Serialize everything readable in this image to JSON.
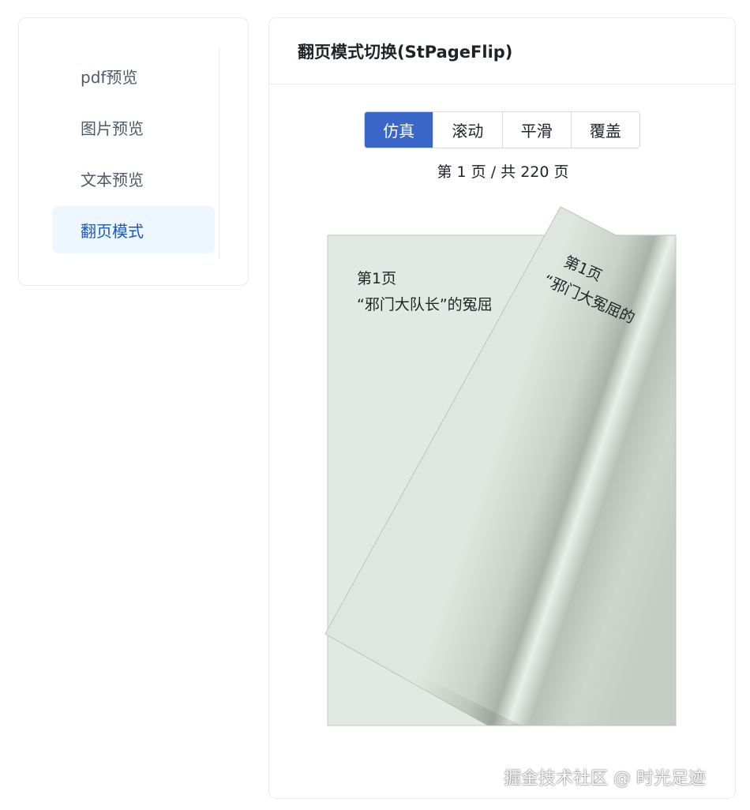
{
  "sidebar": {
    "items": [
      {
        "label": "pdf预览",
        "active": false
      },
      {
        "label": "图片预览",
        "active": false
      },
      {
        "label": "文本预览",
        "active": false
      },
      {
        "label": "翻页模式",
        "active": true
      }
    ]
  },
  "panel": {
    "title": "翻页模式切换(StPageFlip)",
    "modes": [
      {
        "label": "仿真",
        "active": true
      },
      {
        "label": "滚动",
        "active": false
      },
      {
        "label": "平滑",
        "active": false
      },
      {
        "label": "覆盖",
        "active": false
      }
    ],
    "page_indicator": "第 1 页 / 共 220 页"
  },
  "book": {
    "page_heading": "第1页",
    "page_text": "“邪门大队长”的冤屈",
    "flip_heading": "第1页",
    "flip_text": "“邪门大冤屈的",
    "page_color": "#e2e9e2",
    "accent": "#3a66c8"
  },
  "watermark": "掘金技术社区 @ 时光足迹"
}
